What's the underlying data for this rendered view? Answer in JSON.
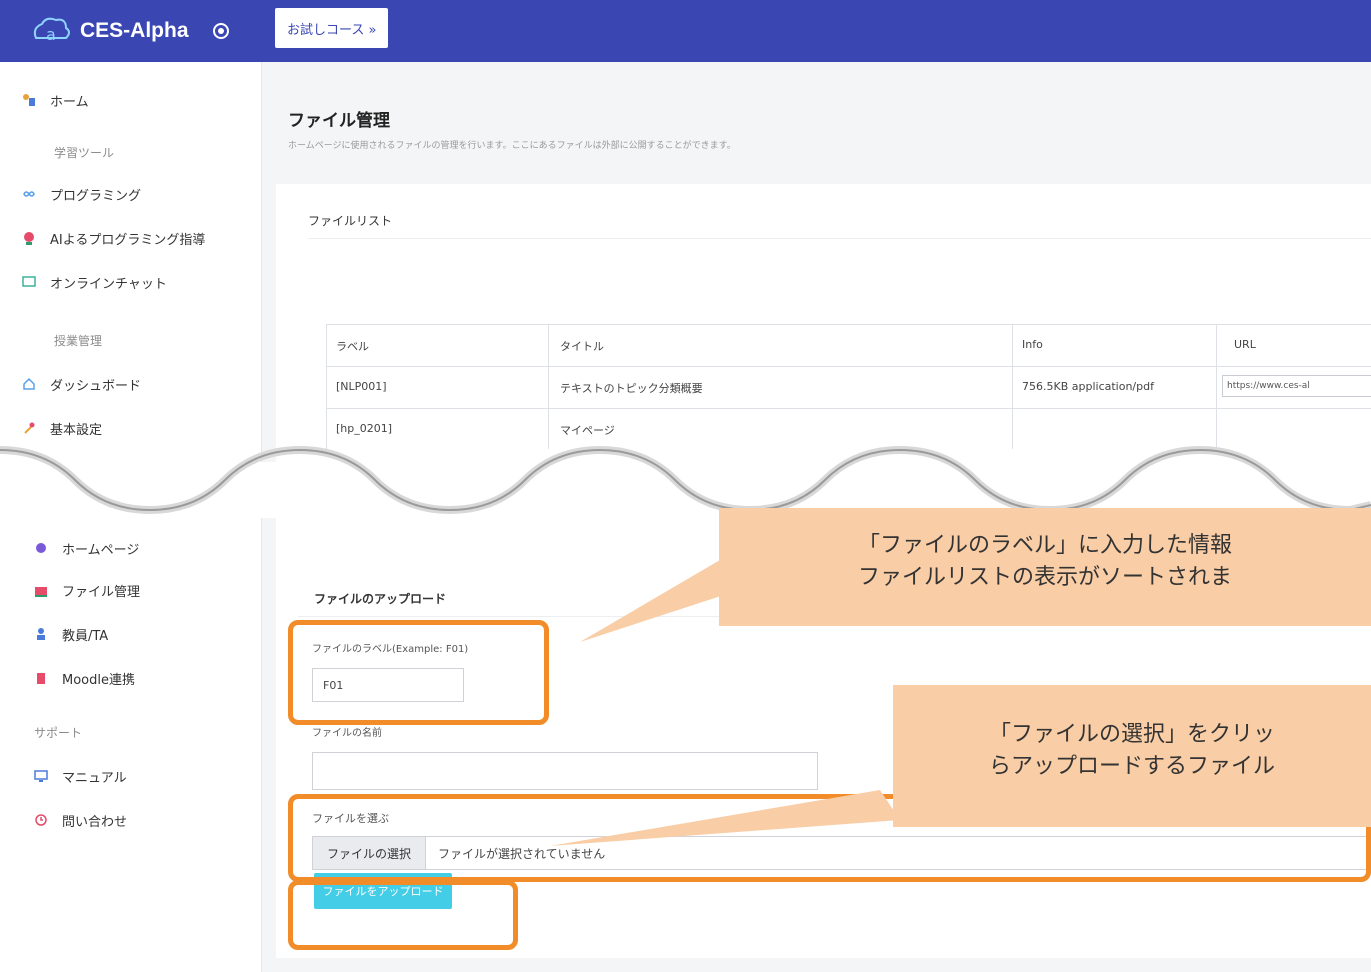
{
  "topbar": {
    "app_name": "CES-Alpha",
    "course_tab": "お試しコース »"
  },
  "sidebar_top": {
    "items": [
      {
        "label": "ホーム",
        "icon": "home-figure-icon"
      },
      {
        "label": "プログラミング",
        "icon": "infinity-icon"
      },
      {
        "label": "AIよるプログラミング指導",
        "icon": "robot-icon"
      },
      {
        "label": "オンラインチャット",
        "icon": "chat-icon"
      },
      {
        "label": "ダッシュボード",
        "icon": "house-icon"
      },
      {
        "label": "基本設定",
        "icon": "wrench-icon"
      }
    ],
    "section_learning": "学習ツール",
    "section_class": "授業管理"
  },
  "page": {
    "title": "ファイル管理",
    "description": "ホームページに使用されるファイルの管理を行います。ここにあるファイルは外部に公開することができます。"
  },
  "file_list": {
    "title": "ファイルリスト",
    "headers": [
      "ラベル",
      "タイトル",
      "Info",
      "URL"
    ],
    "rows": [
      {
        "label": "[NLP001]",
        "title": "テキストのトピック分類概要",
        "info": "756.5KB application/pdf",
        "url": "https://www.ces-al"
      },
      {
        "label": "[hp_0201]",
        "title": "マイページ",
        "info": "",
        "url": ""
      }
    ]
  },
  "sidebar_bottom": {
    "items": [
      {
        "label": "ホームページ",
        "icon": "globe-icon"
      },
      {
        "label": "ファイル管理",
        "icon": "folder-icon"
      },
      {
        "label": "教員/TA",
        "icon": "user-icon"
      },
      {
        "label": "Moodle連携",
        "icon": "moodle-icon"
      },
      {
        "label": "マニュアル",
        "icon": "monitor-icon"
      },
      {
        "label": "問い合わせ",
        "icon": "clock-icon"
      }
    ],
    "section_support": "サポート"
  },
  "upload": {
    "title": "ファイルのアップロード",
    "label_field_label": "ファイルのラベル(Example: F01)",
    "label_field_value": "F01",
    "name_field_label": "ファイルの名前",
    "name_field_value": "",
    "choose_label": "ファイルを選ぶ",
    "choose_button": "ファイルの選択",
    "choose_status": "ファイルが選択されていません",
    "upload_button": "ファイルをアップロード"
  },
  "callouts": {
    "label_line1": "「ファイルのラベル」に入力した情報",
    "label_line2": "ファイルリストの表示がソートされま",
    "choose_line1": "「ファイルの選択」をクリッ",
    "choose_line2": "らアップロードするファイル"
  },
  "colors": {
    "topbar": "#3a47b3",
    "highlight": "#f28c28",
    "callout": "#f9cda6",
    "upload_button": "#43cde6"
  }
}
